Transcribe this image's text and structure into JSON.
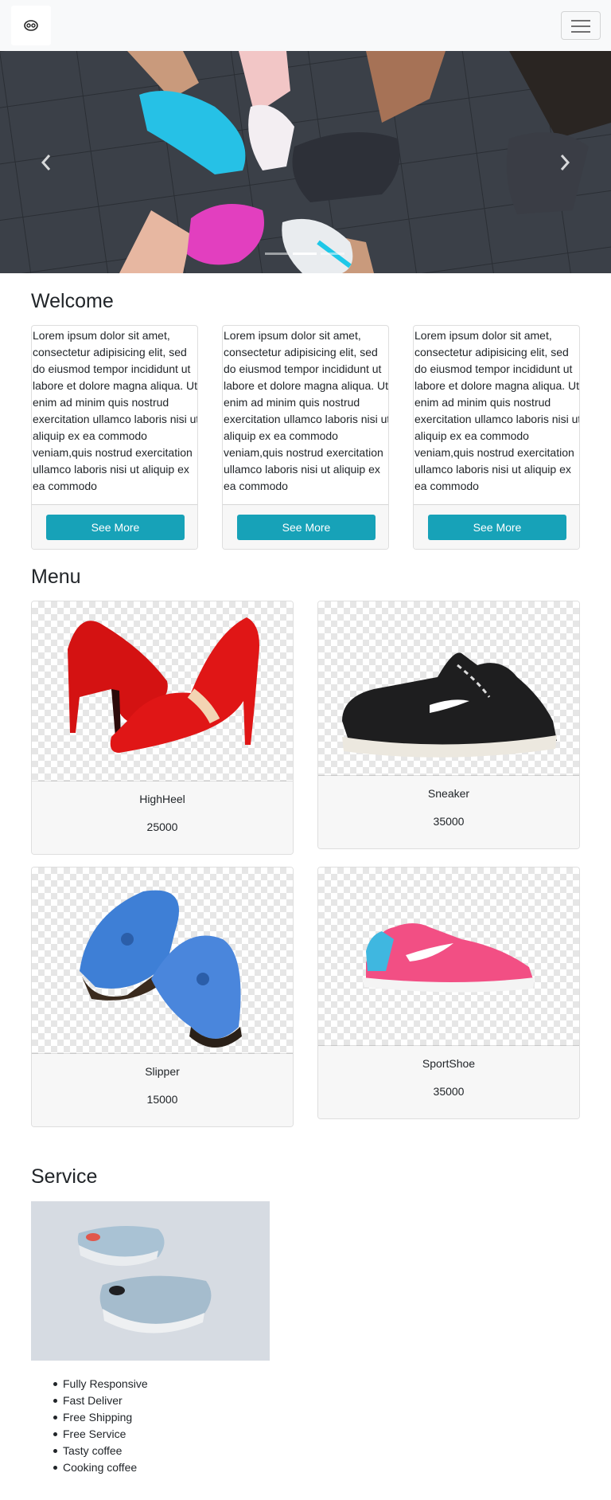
{
  "navbar": {
    "brand_icon": "shoe-logo-icon",
    "toggler_icon": "hamburger-icon"
  },
  "carousel": {
    "prev_icon": "chevron-left-icon",
    "next_icon": "chevron-right-icon",
    "slide_count": 3,
    "active_slide": 2
  },
  "welcome": {
    "title": "Welcome",
    "cards": [
      {
        "text": "Lorem ipsum dolor sit amet, consectetur adipisicing elit, sed do eiusmod tempor incididunt ut labore et dolore magna aliqua. Ut enim ad minim quis nostrud exercitation ullamco laboris nisi ut aliquip ex ea commodo veniam,quis nostrud exercitation ullamco laboris nisi ut aliquip ex ea commodo",
        "button": "See More"
      },
      {
        "text": "Lorem ipsum dolor sit amet, consectetur adipisicing elit, sed do eiusmod tempor incididunt ut labore et dolore magna aliqua. Ut enim ad minim quis nostrud exercitation ullamco laboris nisi ut aliquip ex ea commodo veniam,quis nostrud exercitation ullamco laboris nisi ut aliquip ex ea commodo",
        "button": "See More"
      },
      {
        "text": "Lorem ipsum dolor sit amet, consectetur adipisicing elit, sed do eiusmod tempor incididunt ut labore et dolore magna aliqua. Ut enim ad minim quis nostrud exercitation ullamco laboris nisi ut aliquip ex ea commodo veniam,quis nostrud exercitation ullamco laboris nisi ut aliquip ex ea commodo",
        "button": "See More"
      }
    ]
  },
  "menu": {
    "title": "Menu",
    "items": [
      {
        "name": "HighHeel",
        "price": "25000"
      },
      {
        "name": "Sneaker",
        "price": "35000"
      },
      {
        "name": "Slipper",
        "price": "15000"
      },
      {
        "name": "SportShoe",
        "price": "35000"
      }
    ]
  },
  "service": {
    "title": "Service",
    "items": [
      "Fully Responsive",
      "Fast Deliver",
      "Free Shipping",
      "Free Service",
      "Tasty coffee",
      "Cooking coffee"
    ]
  },
  "colors": {
    "primary_button": "#17a2b8",
    "navbar_bg": "#f8f9fa",
    "card_footer": "#f7f7f7"
  }
}
